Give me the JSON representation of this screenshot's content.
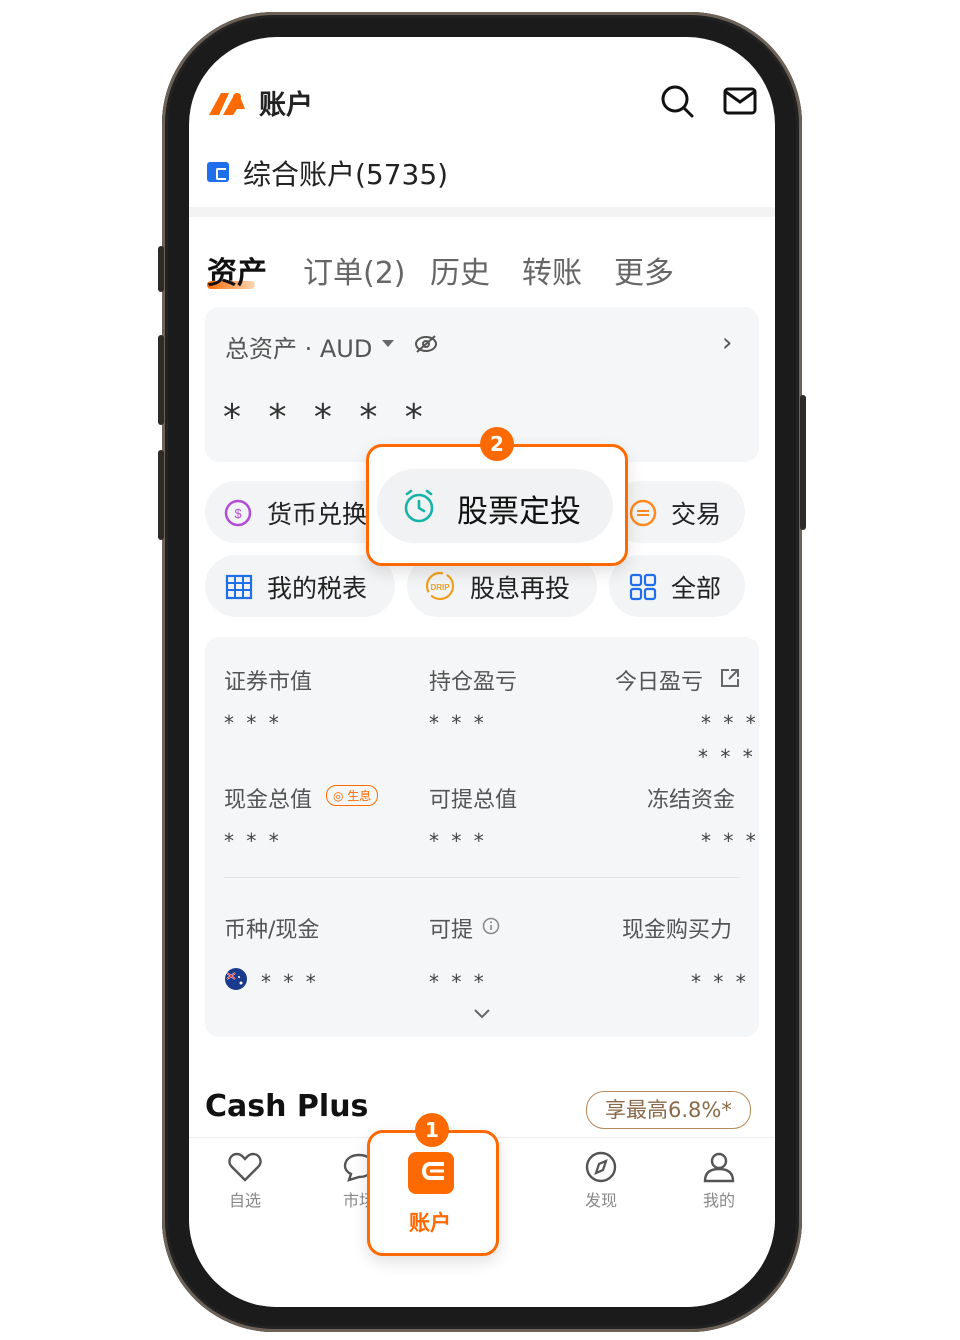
{
  "header": {
    "title": "账户"
  },
  "account": {
    "label": "综合账户(5735)"
  },
  "tabs": [
    {
      "label": "资产"
    },
    {
      "label": "订单(2)"
    },
    {
      "label": "历史"
    },
    {
      "label": "转账"
    },
    {
      "label": "更多"
    }
  ],
  "total_assets": {
    "label": "总资产 · AUD",
    "masked_value": "* * * * *"
  },
  "actions": [
    {
      "label": "货币兑换",
      "icon": "currency-exchange-icon"
    },
    {
      "label": "股票定投",
      "icon": "clock-icon"
    },
    {
      "label": "交易",
      "icon": "trade-icon"
    },
    {
      "label": "我的税表",
      "icon": "table-icon"
    },
    {
      "label": "股息再投",
      "icon": "drip-icon",
      "icon_text": "DRIP"
    },
    {
      "label": "全部",
      "icon": "grid-icon"
    }
  ],
  "summary": {
    "row1": [
      {
        "label": "证券市值",
        "value": "* * *"
      },
      {
        "label": "持仓盈亏",
        "value": "* * *"
      },
      {
        "label": "今日盈亏",
        "value": "* * *",
        "value2": "* * *"
      }
    ],
    "row2": [
      {
        "label": "现金总值",
        "badge": "生息",
        "value": "* * *"
      },
      {
        "label": "可提总值",
        "value": "* * *"
      },
      {
        "label": "冻结资金",
        "value": "* * *"
      }
    ],
    "currency_header": [
      {
        "label": "币种/现金"
      },
      {
        "label": "可提"
      },
      {
        "label": "现金购买力"
      }
    ],
    "currency_row": [
      {
        "value": "* * *"
      },
      {
        "value": "* * *"
      },
      {
        "value": "* * *"
      }
    ]
  },
  "cash_plus": {
    "title": "Cash Plus",
    "promo": "享最高6.8%*"
  },
  "tabbar": [
    {
      "label": "自选",
      "icon": "heart-icon"
    },
    {
      "label": "市场",
      "icon": "chat-icon"
    },
    {
      "label": "账户",
      "icon": "wallet-icon"
    },
    {
      "label": "发现",
      "icon": "compass-icon"
    },
    {
      "label": "我的",
      "icon": "user-icon"
    }
  ],
  "annotations": [
    {
      "number": "1"
    },
    {
      "number": "2"
    }
  ],
  "colors": {
    "accent": "#ff6a00",
    "brand_blue": "#1f6feb",
    "card_bg": "#f5f6f7"
  }
}
